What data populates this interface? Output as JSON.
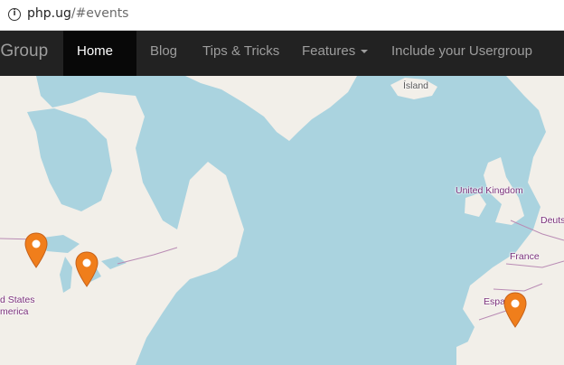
{
  "browser": {
    "url_host": "php.ug",
    "url_path": "/#events"
  },
  "navbar": {
    "brand": "rGroup",
    "items": [
      {
        "label": "Home",
        "active": true,
        "caret": true
      },
      {
        "label": "Blog"
      },
      {
        "label": "Tips & Tricks"
      },
      {
        "label": "Features",
        "caret": true
      },
      {
        "label": "Include your Usergroup"
      }
    ]
  },
  "map": {
    "labels": {
      "island": "Ísland",
      "uk": "United Kingdom",
      "france": "France",
      "deutschland": "Deuts",
      "espana": "Espa",
      "us_line1": "d States",
      "us_line2": "merica"
    },
    "colors": {
      "water": "#aad3df",
      "land": "#f2efe9",
      "marker": "#f07e1b",
      "border": "#b98bb4"
    }
  }
}
